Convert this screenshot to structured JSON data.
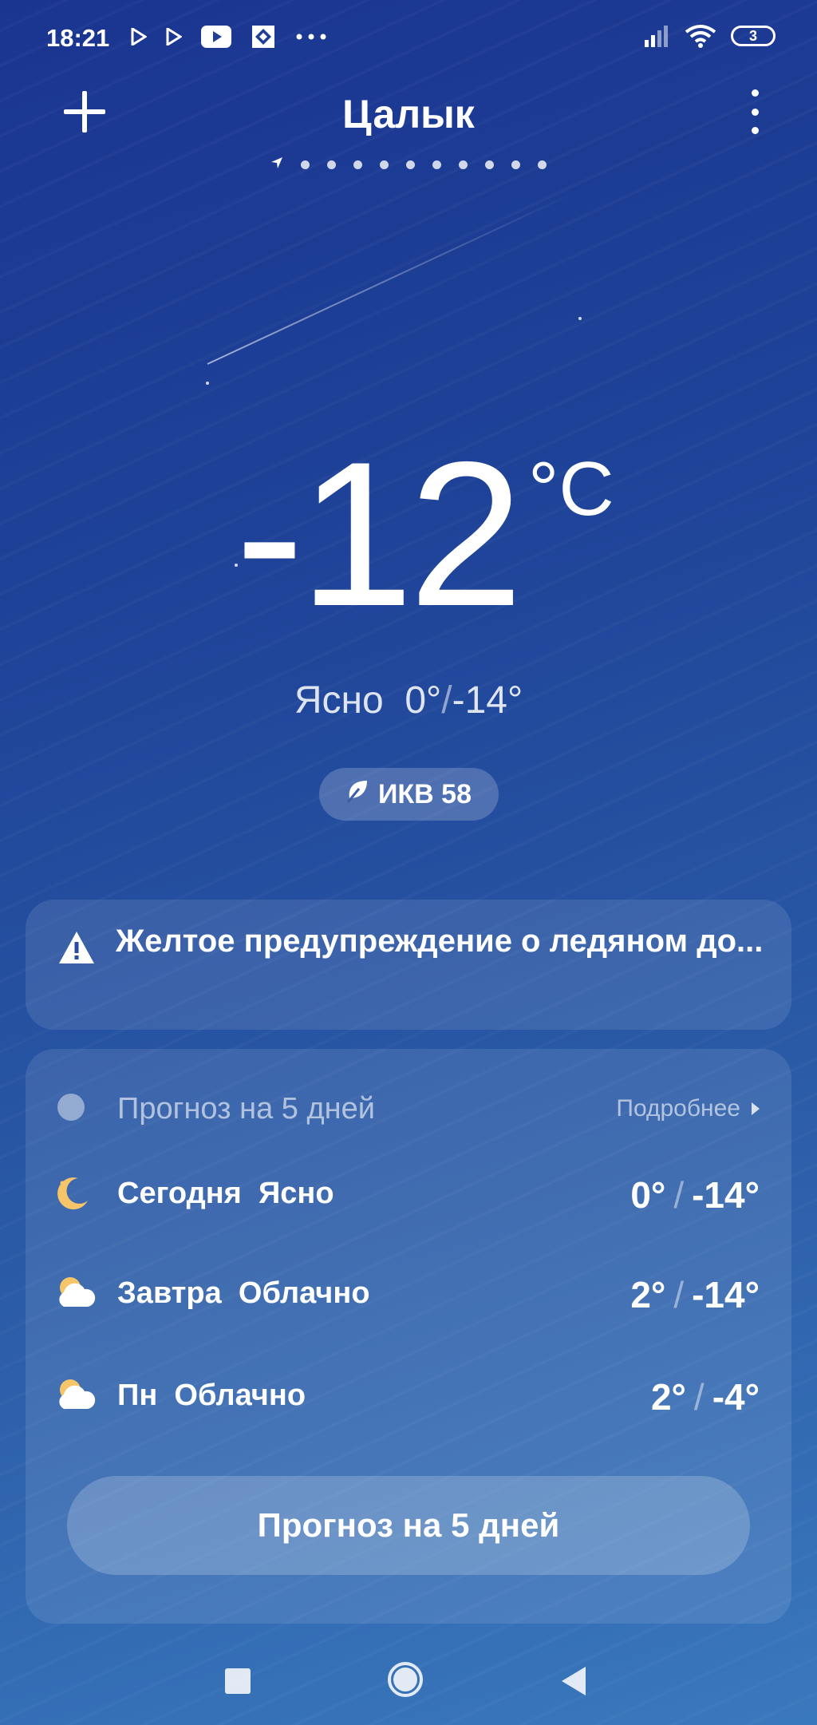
{
  "status_bar": {
    "time": "18:21",
    "battery": "3",
    "left_icons": [
      "play-store-icon",
      "play-store-icon",
      "youtube-icon",
      "app-icon",
      "more-dots-icon"
    ],
    "right_icons": [
      "signal-icon",
      "wifi-icon",
      "battery-icon"
    ]
  },
  "header": {
    "city": "Цалык",
    "page_count": 11,
    "current_page": 0
  },
  "current": {
    "temperature": "-12",
    "unit": "°C",
    "condition": "Ясно",
    "high": "0°",
    "low": "-14°",
    "aqi_label": "ИКВ 58"
  },
  "warning": {
    "text": "Желтое предупреждение о ледяном до..."
  },
  "forecast": {
    "title": "Прогноз на 5 дней",
    "more_label": "Подробнее",
    "days": [
      {
        "day": "Сегодня",
        "condition": "Ясно",
        "high": "0°",
        "low": "-14°",
        "icon": "moon-icon"
      },
      {
        "day": "Завтра",
        "condition": "Облачно",
        "high": "2°",
        "low": "-14°",
        "icon": "cloudy-icon"
      },
      {
        "day": "Пн",
        "condition": "Облачно",
        "high": "2°",
        "low": "-4°",
        "icon": "cloudy-icon"
      }
    ],
    "button_label": "Прогноз на 5 дней"
  },
  "colors": {
    "accent_moon": "#f6c56a",
    "background_top": "#1a3590",
    "background_bottom": "#3a78bd"
  }
}
